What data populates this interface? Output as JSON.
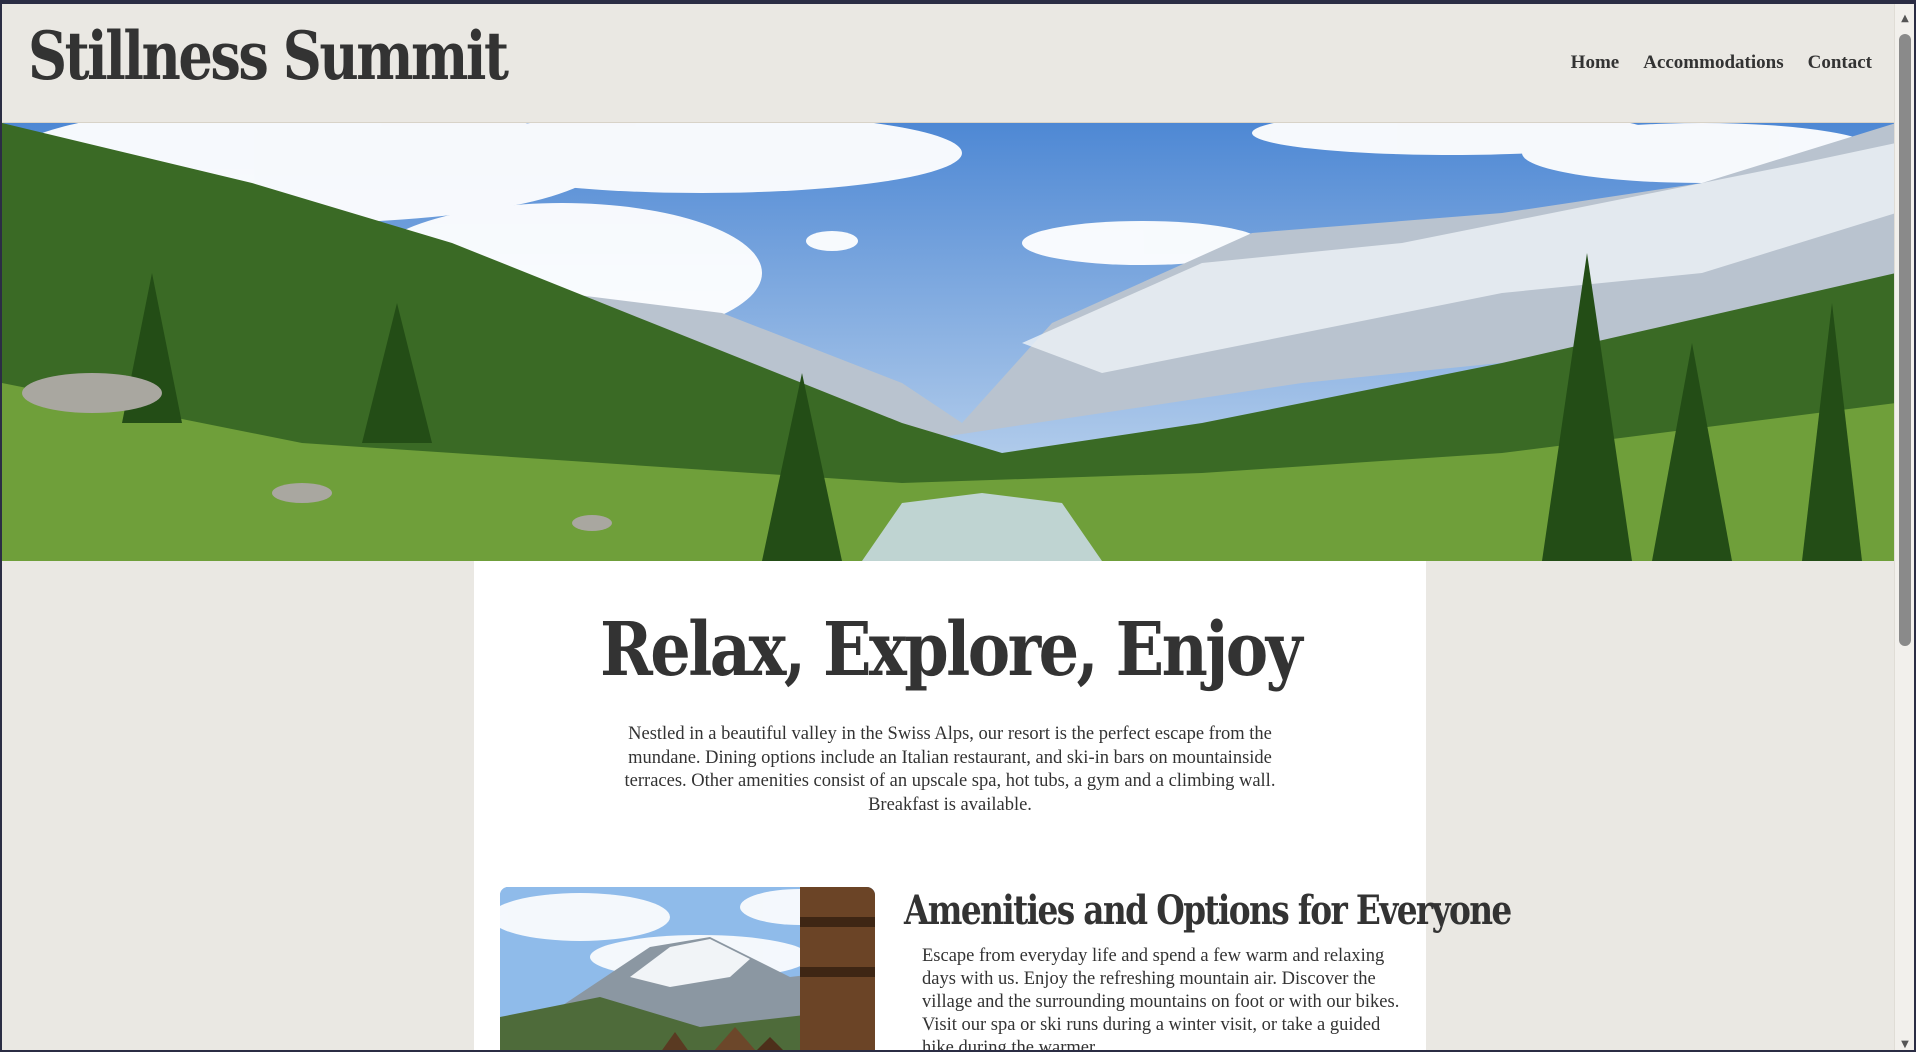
{
  "header": {
    "logo_text": "Stillness Summit",
    "nav": [
      {
        "label": "Home"
      },
      {
        "label": "Accommodations"
      },
      {
        "label": "Contact"
      }
    ]
  },
  "hero": {
    "image": "alpine-valley-landscape"
  },
  "main": {
    "headline": "Relax, Explore, Enjoy",
    "intro": "Nestled in a beautiful valley in the Swiss Alps, our resort is the perfect escape from the mundane. Dining options include an Italian restaurant, and ski-in bars on mountainside terraces. Other amenities consist of an upscale spa, hot tubs, a gym and a climbing wall. Breakfast is available.",
    "amenities": {
      "image": "alpine-village-chalets",
      "title": "Amenities and Options for Everyone",
      "text": "Escape from everyday life and spend a few warm and relaxing days with us. Enjoy the refreshing mountain air. Discover the village and the surrounding mountains on foot or with our bikes. Visit our spa or ski runs during a winter visit, or take a guided hike during the warmer"
    }
  },
  "scrollbar": {
    "up_icon": "▲",
    "down_icon": "▼",
    "position": 0
  }
}
